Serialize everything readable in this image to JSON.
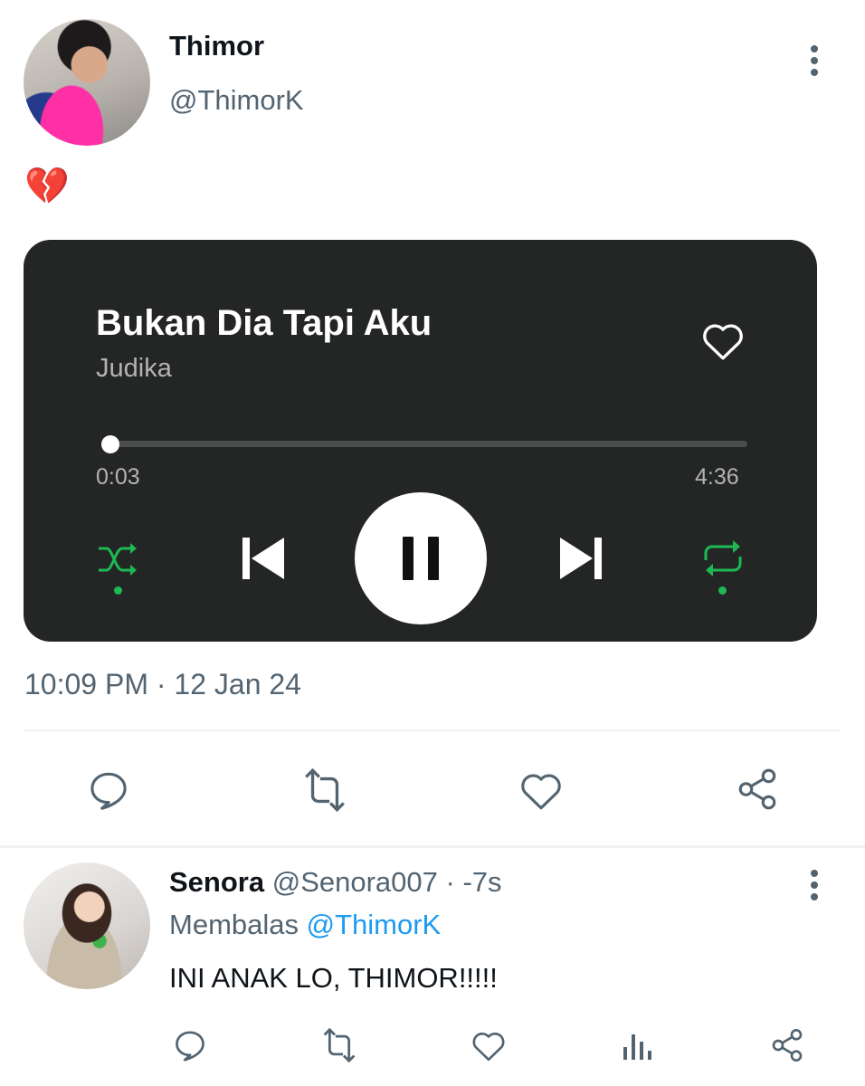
{
  "tweet": {
    "author_name": "Thimor",
    "author_handle": "@ThimorK",
    "text": "💔",
    "timestamp": "10:09 PM · 12 Jan 24"
  },
  "player": {
    "song_title": "Bukan Dia Tapi Aku",
    "artist": "Judika",
    "elapsed": "0:03",
    "duration": "4:36",
    "progress_fraction": 0.011,
    "shuffle_on": true,
    "repeat_on": true,
    "state": "playing",
    "accent_color": "#1db954"
  },
  "actions": [
    "reply-icon",
    "retweet-icon",
    "like-icon",
    "share-icon"
  ],
  "reply": {
    "author_name": "Senora",
    "author_handle": "@Senora007",
    "time_ago": "· -7s",
    "replying_prefix": "Membalas",
    "replying_to": "@ThimorK",
    "text": "INI ANAK LO, THIMOR!!!!!"
  },
  "reply_actions": [
    "reply-icon",
    "retweet-icon",
    "like-icon",
    "views-icon",
    "share-icon"
  ]
}
